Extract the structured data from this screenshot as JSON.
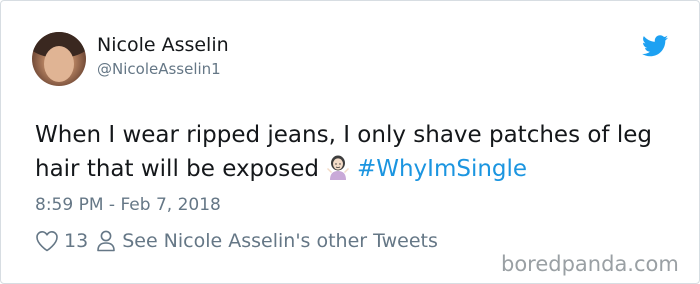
{
  "author": {
    "name": "Nicole Asselin",
    "handle": "@NicoleAsselin1"
  },
  "tweet": {
    "text_before_emoji": "When I wear ripped jeans, I only shave patches of leg hair that will be exposed",
    "emoji": "woman-shrugging-emoji",
    "hashtag": "#WhyImSingle",
    "timestamp": "8:59 PM - Feb 7, 2018"
  },
  "actions": {
    "like_count": "13",
    "profile_link_label": "See Nicole Asselin's other Tweets"
  },
  "watermark": "boredpanda.com",
  "colors": {
    "twitter_blue": "#1b95e0",
    "secondary_text": "#657786",
    "primary_text": "#14171a"
  }
}
